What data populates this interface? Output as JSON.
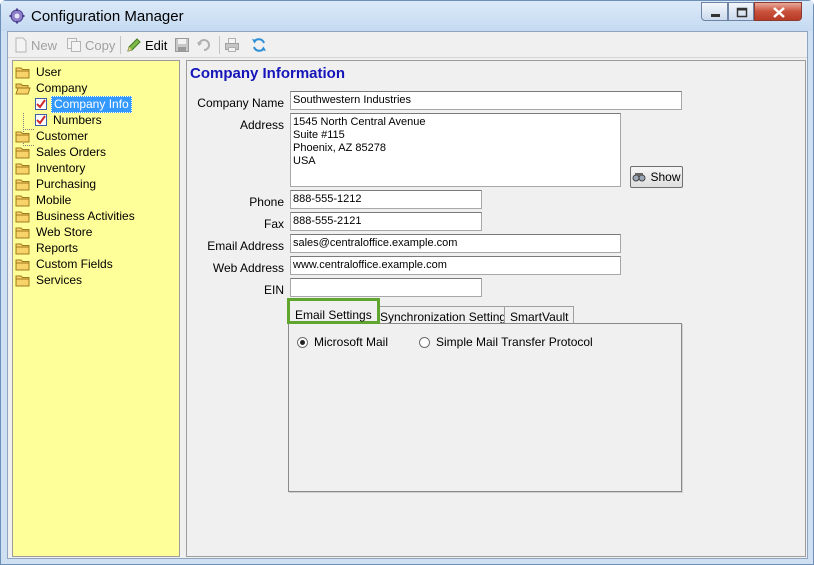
{
  "window": {
    "title": "Configuration Manager"
  },
  "toolbar": {
    "new_label": "New",
    "copy_label": "Copy",
    "edit_label": "Edit"
  },
  "tree": {
    "items": [
      {
        "label": "User"
      },
      {
        "label": "Company"
      },
      {
        "label": "Company Info"
      },
      {
        "label": "Numbers"
      },
      {
        "label": "Customer"
      },
      {
        "label": "Sales Orders"
      },
      {
        "label": "Inventory"
      },
      {
        "label": "Purchasing"
      },
      {
        "label": "Mobile"
      },
      {
        "label": "Business Activities"
      },
      {
        "label": "Web Store"
      },
      {
        "label": "Reports"
      },
      {
        "label": "Custom Fields"
      },
      {
        "label": "Services"
      }
    ]
  },
  "form": {
    "heading": "Company Information",
    "company_name": {
      "label": "Company Name",
      "value": "Southwestern Industries"
    },
    "address": {
      "label": "Address",
      "value": "1545 North Central Avenue\nSuite #115\nPhoenix, AZ 85278\nUSA"
    },
    "show_button": "Show",
    "phone": {
      "label": "Phone",
      "value": "888-555-1212"
    },
    "fax": {
      "label": "Fax",
      "value": "888-555-2121"
    },
    "email": {
      "label": "Email Address",
      "value": "sales@centraloffice.example.com"
    },
    "web": {
      "label": "Web Address",
      "value": "www.centraloffice.example.com"
    },
    "ein": {
      "label": "EIN",
      "value": ""
    }
  },
  "tabs": [
    {
      "label": "Email Settings"
    },
    {
      "label": "Synchronization Settings"
    },
    {
      "label": "SmartVault"
    }
  ],
  "email_settings": {
    "option_microsoft": "Microsoft Mail",
    "option_smtp": "Simple Mail Transfer Protocol",
    "selected": "Microsoft Mail"
  },
  "colors": {
    "tree_background": "#ffff99",
    "heading": "#1515b9",
    "active_tab_highlight": "#5fa52e",
    "selection": "#3399ff"
  }
}
